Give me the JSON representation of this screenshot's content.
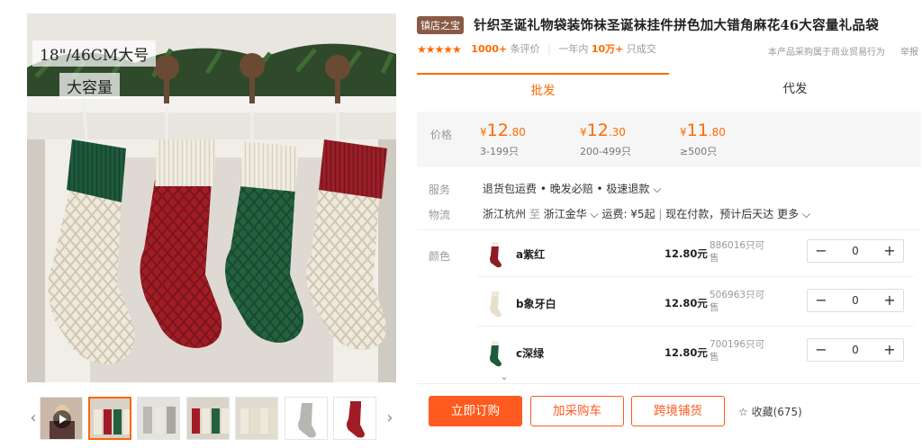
{
  "product_image": {
    "caption_size": "18\"/46CM大号",
    "caption_capacity": "大容量"
  },
  "gallery": {
    "prev": "‹",
    "next": "›"
  },
  "product": {
    "badge": "镇店之宝",
    "title": "针织圣诞礼物袋装饰袜圣诞袜挂件拼色加大错角麻花46大容量礼品袋"
  },
  "rating": {
    "stars": "★★★★★",
    "review_count": "1000+",
    "review_label": "条评价",
    "period_label": "一年内",
    "sold_count": "10万+",
    "sold_label": "只成交",
    "disclaimer": "本产品采购属于商业贸易行为",
    "report": "举报"
  },
  "tabs": [
    {
      "label": "批发"
    },
    {
      "label": "代发"
    }
  ],
  "price": {
    "label": "价格",
    "tiers": [
      {
        "currency": "¥",
        "int": "12",
        "dec": ".80",
        "qty": "3-199只"
      },
      {
        "currency": "¥",
        "int": "12",
        "dec": ".30",
        "qty": "200-499只"
      },
      {
        "currency": "¥",
        "int": "11",
        "dec": ".80",
        "qty": "≥500只"
      }
    ]
  },
  "service": {
    "label": "服务",
    "value": "退货包运费 • 晚发必赔 • 极速退款 ⌵"
  },
  "logistics": {
    "label": "物流",
    "from": "浙江杭州",
    "to_word": "至",
    "to": "浙江金华 ⌵",
    "freight": "运费: ¥5起",
    "eta": "现在付款，预计后天达",
    "more": "更多 ⌵"
  },
  "color": {
    "label": "颜色",
    "skus": [
      {
        "name": "a紫红",
        "price": "12.80元",
        "stock": "886016只可售",
        "qty": "0",
        "swatch": "#8f1b24",
        "cuff": "#f1ede2"
      },
      {
        "name": "b象牙白",
        "price": "12.80元",
        "stock": "506963只可售",
        "qty": "0",
        "swatch": "#ece6d6",
        "cuff": "#9a1f28"
      },
      {
        "name": "c深绿",
        "price": "12.80元",
        "stock": "700196只可售",
        "qty": "0",
        "swatch": "#1f5a3c",
        "cuff": "#f1ede2"
      }
    ]
  },
  "stepper": {
    "minus": "−",
    "plus": "+"
  },
  "actions": {
    "buy_now": "立即订购",
    "add_cart": "加采购车",
    "cross_border": "跨境铺货",
    "favorite_icon": "☆",
    "favorite": "收藏(675)"
  },
  "colors": {
    "accent": "#ff5a1f",
    "brand_orange": "#ff6a00",
    "badge_brown": "#8a5a44"
  }
}
